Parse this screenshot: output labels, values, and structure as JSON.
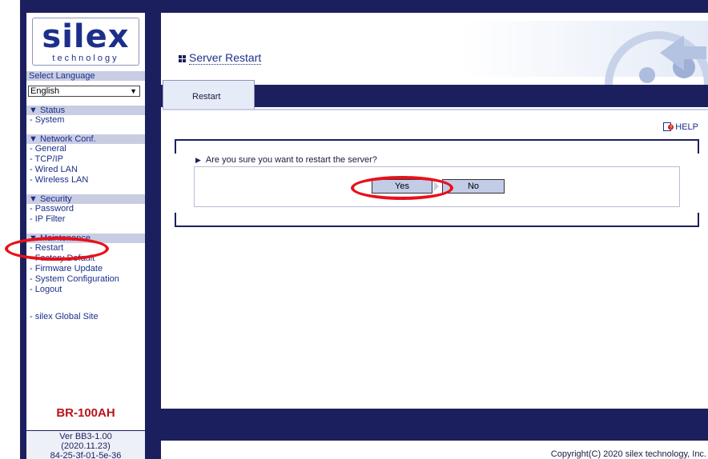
{
  "logo": {
    "main": "silex",
    "sub": "technology"
  },
  "language": {
    "label": "Select Language",
    "selected": "English"
  },
  "sidebar": {
    "status": {
      "head": "▼ Status",
      "items": [
        "- System"
      ]
    },
    "network": {
      "head": "▼ Network Conf.",
      "items": [
        "- General",
        "- TCP/IP",
        "- Wired LAN",
        "- Wireless LAN"
      ]
    },
    "security": {
      "head": "▼ Security",
      "items": [
        "- Password",
        "- IP Filter"
      ]
    },
    "maintenance": {
      "head": "▼ Maintenance",
      "items": [
        "- Restart",
        "- Factory Default",
        "- Firmware Update",
        "- System Configuration",
        "- Logout"
      ]
    },
    "global_site": "- silex Global Site"
  },
  "device": {
    "model": "BR-100AH",
    "version": "Ver BB3-1.00",
    "date": "(2020.11.23)",
    "mac": "84-25-3f-01-5e-36"
  },
  "page": {
    "title": "Server Restart",
    "tab": "Restart",
    "help": "HELP"
  },
  "dialog": {
    "question": "Are you sure you want to restart the server?",
    "yes": "Yes",
    "no": "No"
  },
  "footer": {
    "copyright": "Copyright(C) 2020 silex technology, Inc."
  },
  "colors": {
    "navy": "#1c1f5e",
    "accent": "#1c2f8a",
    "model_red": "#b8141a",
    "annotation": "#e8101a"
  }
}
